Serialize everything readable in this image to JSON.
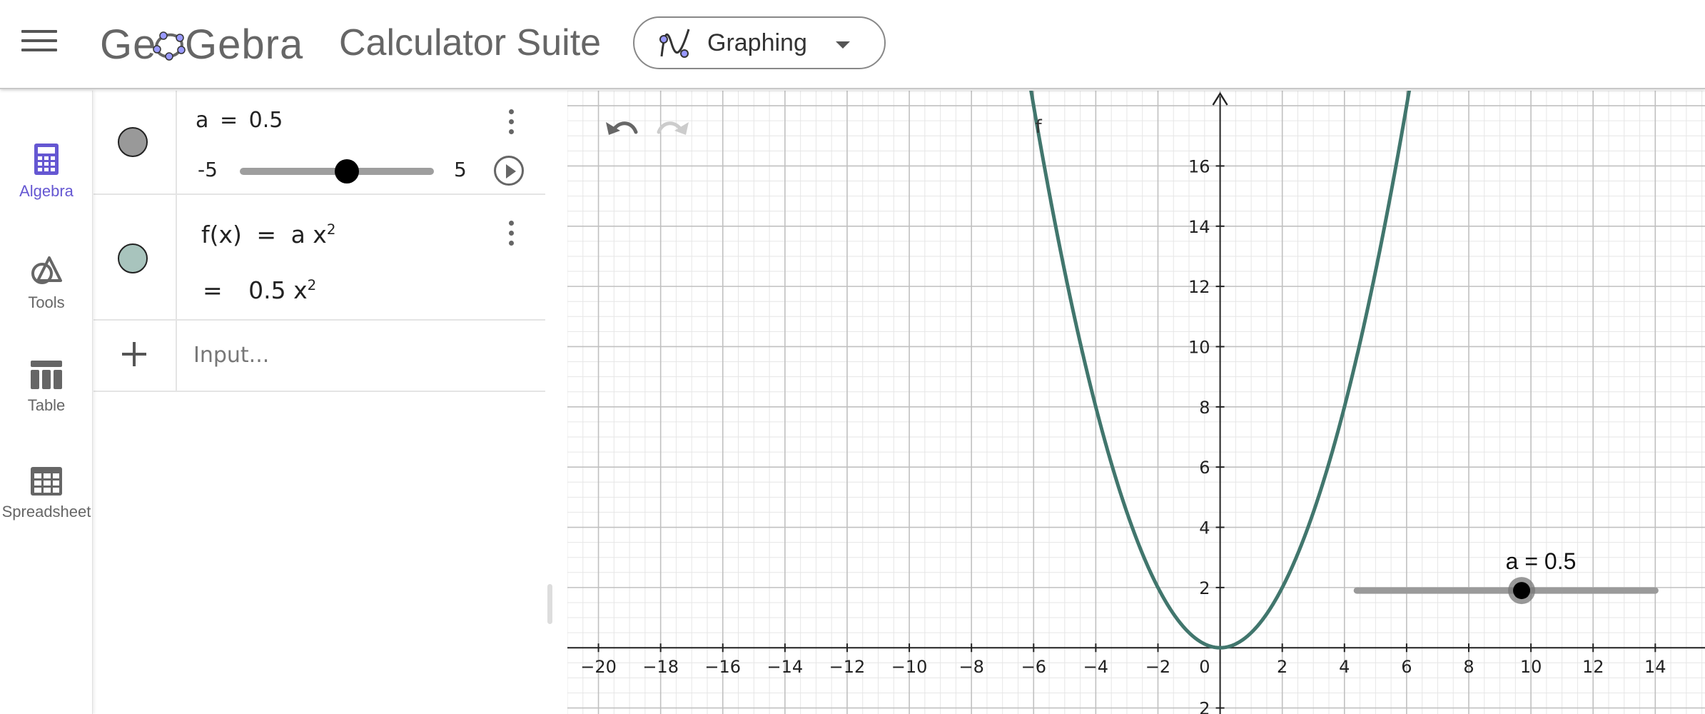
{
  "header": {
    "logo_text": "GeoGebra",
    "app_title": "Calculator Suite",
    "mode_label": "Graphing"
  },
  "rail": {
    "items": [
      {
        "label": "Algebra",
        "icon": "calculator-icon",
        "active": true
      },
      {
        "label": "Tools",
        "icon": "shapes-icon",
        "active": false
      },
      {
        "label": "Table",
        "icon": "table-icon",
        "active": false
      },
      {
        "label": "Spreadsheet",
        "icon": "spreadsheet-icon",
        "active": false
      }
    ]
  },
  "algebra": {
    "slider_row": {
      "name": "a",
      "equals": "=",
      "value": "0.5",
      "min_label": "-5",
      "max_label": "5",
      "fraction": 0.55,
      "marble_color": "#999999"
    },
    "function_row": {
      "definition_lhs": "f(x)",
      "equals": "=",
      "definition_rhs": "a x",
      "exponent": "2",
      "value_equals": "=",
      "value_rhs": "0.5 x",
      "value_exponent": "2",
      "marble_color": "#a8c4bd"
    },
    "input_placeholder": "Input..."
  },
  "graph": {
    "curve_color": "#41766d",
    "accent_color": "#6557d2",
    "function_label": "f",
    "coefficient": 0.5,
    "x_range": [
      -21,
      15.6
    ],
    "y_range": [
      -2.2,
      18.5
    ],
    "x_ticks": [
      "−20",
      "−18",
      "−16",
      "−14",
      "−12",
      "−10",
      "−8",
      "−6",
      "−4",
      "−2",
      "2",
      "4",
      "6",
      "8",
      "10",
      "12",
      "14"
    ],
    "x_tick_values": [
      -20,
      -18,
      -16,
      -14,
      -12,
      -10,
      -8,
      -6,
      -4,
      -2,
      2,
      4,
      6,
      8,
      10,
      12,
      14
    ],
    "y_ticks": [
      "2",
      "4",
      "6",
      "8",
      "10",
      "12",
      "14",
      "16"
    ],
    "y_tick_values": [
      2,
      4,
      6,
      8,
      10,
      12,
      14,
      16
    ],
    "origin_label": "0",
    "partial_tick_label": "2",
    "slider_caption": "a = 0.5",
    "slider_track_x": [
      4.4,
      14
    ],
    "slider_y": 1.9,
    "slider_knob_x": 9.7
  }
}
